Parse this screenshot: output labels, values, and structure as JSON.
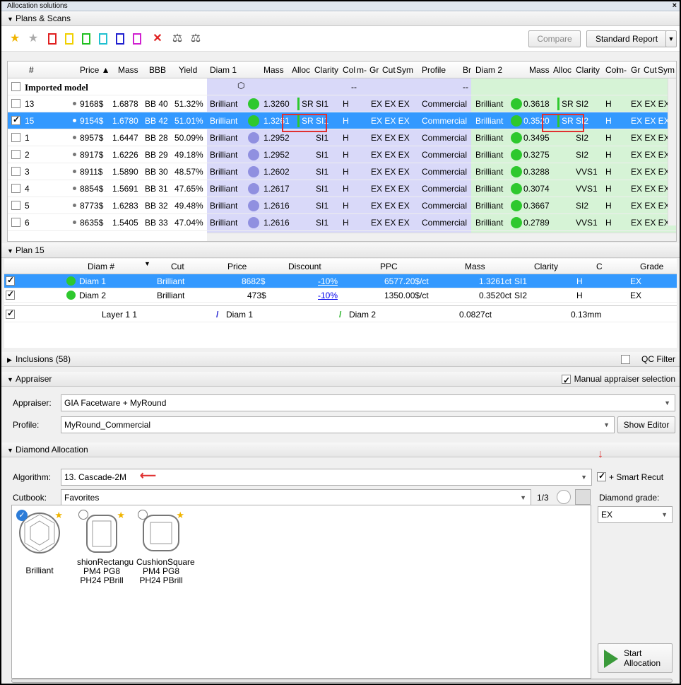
{
  "window": {
    "title": "Allocation solutions",
    "close": "×"
  },
  "plans_scans": {
    "header": "Plans & Scans",
    "compare": "Compare",
    "report": "Standard Report",
    "columns": [
      "#",
      "Price ▲",
      "Mass",
      "BBB",
      "Yield",
      "Diam 1",
      "Mass",
      "Alloc",
      "Clarity",
      "Col",
      "m-",
      "Gr",
      "Cut",
      "Sym",
      "Profile",
      "Br",
      "Diam 2",
      "Mass",
      "Alloc",
      "Clarity",
      "Col",
      "m-",
      "Gr",
      "Cut",
      "Sym"
    ],
    "imported": "Imported model",
    "imported_d1": "--",
    "imported_d2": "--",
    "rows": [
      {
        "num": "13",
        "price": "9168$",
        "mass": "1.6878",
        "bbb": "BB 40",
        "yield": "51.32%",
        "d1": "Brilliant",
        "m1": "1.3260",
        "a1": "SR",
        "c1": "SI1",
        "col1": "H",
        "g1": "EX EX EX",
        "prof": "Commercial",
        "d2": "Brilliant",
        "m2": "0.3618",
        "a2": "SR",
        "c2": "SI2",
        "col2": "H",
        "g2": "EX EX EX",
        "checked": false,
        "sel": false,
        "bar": true
      },
      {
        "num": "15",
        "price": "9154$",
        "mass": "1.6780",
        "bbb": "BB 42",
        "yield": "51.01%",
        "d1": "Brilliant",
        "m1": "1.3261",
        "a1": "SR",
        "c1": "SI1",
        "col1": "H",
        "g1": "EX EX EX",
        "prof": "Commercial",
        "d2": "Brilliant",
        "m2": "0.3520",
        "a2": "SR",
        "c2": "SI2",
        "col2": "H",
        "g2": "EX EX EX",
        "checked": true,
        "sel": true,
        "bar": true
      },
      {
        "num": "1",
        "price": "8957$",
        "mass": "1.6447",
        "bbb": "BB 28",
        "yield": "50.09%",
        "d1": "Brilliant",
        "m1": "1.2952",
        "a1": "",
        "c1": "SI1",
        "col1": "H",
        "g1": "EX EX EX",
        "prof": "Commercial",
        "d2": "Brilliant",
        "m2": "0.3495",
        "a2": "",
        "c2": "SI2",
        "col2": "H",
        "g2": "EX EX EX",
        "checked": false,
        "sel": false,
        "bar": false
      },
      {
        "num": "2",
        "price": "8917$",
        "mass": "1.6226",
        "bbb": "BB 29",
        "yield": "49.18%",
        "d1": "Brilliant",
        "m1": "1.2952",
        "a1": "",
        "c1": "SI1",
        "col1": "H",
        "g1": "EX EX EX",
        "prof": "Commercial",
        "d2": "Brilliant",
        "m2": "0.3275",
        "a2": "",
        "c2": "SI2",
        "col2": "H",
        "g2": "EX EX EX",
        "checked": false,
        "sel": false,
        "bar": false
      },
      {
        "num": "3",
        "price": "8911$",
        "mass": "1.5890",
        "bbb": "BB 30",
        "yield": "48.57%",
        "d1": "Brilliant",
        "m1": "1.2602",
        "a1": "",
        "c1": "SI1",
        "col1": "H",
        "g1": "EX EX EX",
        "prof": "Commercial",
        "d2": "Brilliant",
        "m2": "0.3288",
        "a2": "",
        "c2": "VVS1",
        "col2": "H",
        "g2": "EX EX EX",
        "checked": false,
        "sel": false,
        "bar": false
      },
      {
        "num": "4",
        "price": "8854$",
        "mass": "1.5691",
        "bbb": "BB 31",
        "yield": "47.65%",
        "d1": "Brilliant",
        "m1": "1.2617",
        "a1": "",
        "c1": "SI1",
        "col1": "H",
        "g1": "EX EX EX",
        "prof": "Commercial",
        "d2": "Brilliant",
        "m2": "0.3074",
        "a2": "",
        "c2": "VVS1",
        "col2": "H",
        "g2": "EX EX EX",
        "checked": false,
        "sel": false,
        "bar": false
      },
      {
        "num": "5",
        "price": "8773$",
        "mass": "1.6283",
        "bbb": "BB 32",
        "yield": "49.48%",
        "d1": "Brilliant",
        "m1": "1.2616",
        "a1": "",
        "c1": "SI1",
        "col1": "H",
        "g1": "EX EX EX",
        "prof": "Commercial",
        "d2": "Brilliant",
        "m2": "0.3667",
        "a2": "",
        "c2": "SI2",
        "col2": "H",
        "g2": "EX EX EX",
        "checked": false,
        "sel": false,
        "bar": false
      },
      {
        "num": "6",
        "price": "8635$",
        "mass": "1.5405",
        "bbb": "BB 33",
        "yield": "47.04%",
        "d1": "Brilliant",
        "m1": "1.2616",
        "a1": "",
        "c1": "SI1",
        "col1": "H",
        "g1": "EX EX EX",
        "prof": "Commercial",
        "d2": "Brilliant",
        "m2": "0.2789",
        "a2": "",
        "c2": "VVS1",
        "col2": "H",
        "g2": "EX EX EX",
        "checked": false,
        "sel": false,
        "bar": false
      }
    ]
  },
  "plan": {
    "header": "Plan 15",
    "columns": [
      "Diam #",
      "Cut",
      "Price",
      "Discount",
      "PPC",
      "Mass",
      "Clarity",
      "C",
      "Grade"
    ],
    "rows": [
      {
        "name": "Diam 1",
        "cut": "Brilliant",
        "price": "8682$",
        "disc": "-10%",
        "ppc": "6577.20$/ct",
        "mass": "1.3261ct",
        "clar": "SI1",
        "c": "H",
        "grade": "EX"
      },
      {
        "name": "Diam 2",
        "cut": "Brilliant",
        "price": "473$",
        "disc": "-10%",
        "ppc": "1350.00$/ct",
        "mass": "0.3520ct",
        "clar": "SI2",
        "c": "H",
        "grade": "EX"
      }
    ],
    "layer": {
      "name": "Layer 1 1",
      "d1": "Diam 1",
      "d2": "Diam 2",
      "mass": "0.0827ct",
      "mm": "0.13mm"
    }
  },
  "inclusions": {
    "header": "Inclusions (58)",
    "qc": "QC Filter"
  },
  "appraiser": {
    "header": "Appraiser",
    "manual": "Manual appraiser selection",
    "label": "Appraiser:",
    "value": "GIA Facetware + MyRound",
    "profile_label": "Profile:",
    "profile": "MyRound_Commercial",
    "show_editor": "Show Editor"
  },
  "allocation": {
    "header": "Diamond Allocation",
    "algo_label": "Algorithm:",
    "algo": "13. Cascade-2M",
    "smart": "+ Smart Recut",
    "cutbook_label": "Cutbook:",
    "cutbook": "Favorites",
    "page": "1/3",
    "grade_label": "Diamond grade:",
    "grade": "EX",
    "shapes": [
      {
        "l1": "Brilliant",
        "l2": "",
        "l3": ""
      },
      {
        "l1": "shionRectangu",
        "l2": "PM4 PG8",
        "l3": "PH24 PBrill"
      },
      {
        "l1": "CushionSquare",
        "l2": "PM4 PG8",
        "l3": "PH24 PBrill"
      }
    ],
    "start": "Start",
    "start2": "Allocation"
  }
}
